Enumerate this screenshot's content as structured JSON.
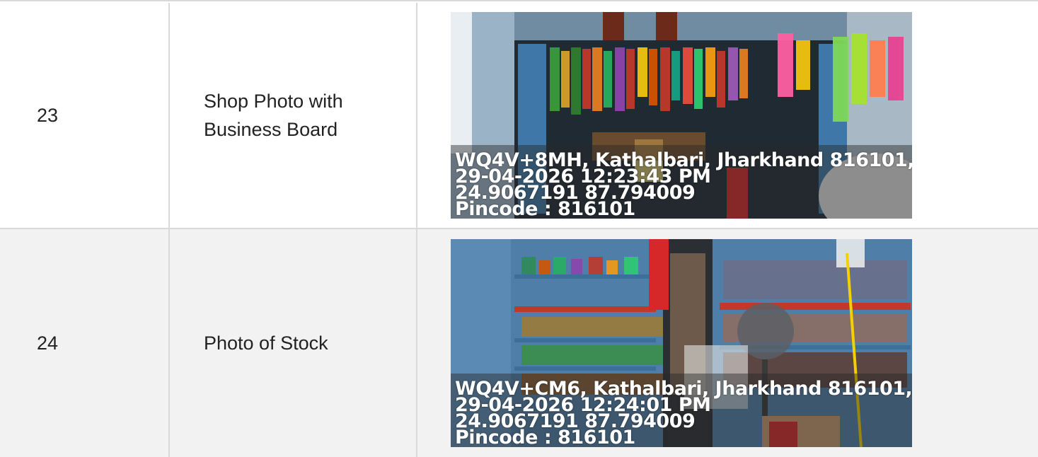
{
  "rows": [
    {
      "number": "23",
      "label": "Shop Photo with Business Board",
      "photo": {
        "address": "WQ4V+8MH, Kathalbari, Jharkhand 816101,",
        "datetime": "29-04-2026 12:23:43 PM",
        "coordinates": "24.9067191 87.794009",
        "pincode": "Pincode : 816101"
      }
    },
    {
      "number": "24",
      "label": "Photo of Stock",
      "photo": {
        "address": "WQ4V+CM6, Kathalbari, Jharkhand 816101,",
        "datetime": "29-04-2026 12:24:01 PM",
        "coordinates": "24.9067191 87.794009",
        "pincode": "Pincode : 816101"
      }
    }
  ],
  "colors": {
    "border": "#d9d9d9",
    "row_alt": "#f2f2f2",
    "shop_wall": "#4f7fa8",
    "shelf_red": "#c0392b"
  }
}
